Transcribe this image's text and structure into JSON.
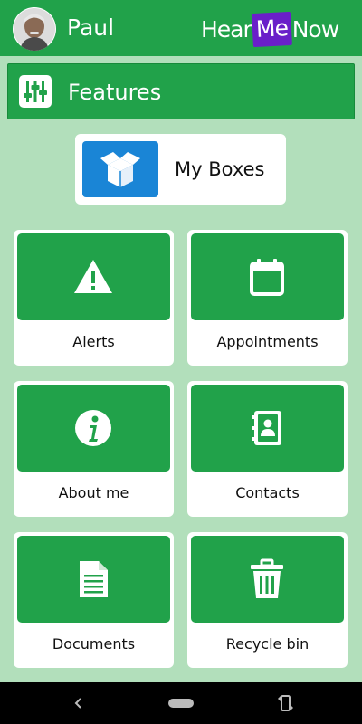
{
  "header": {
    "username": "Paul",
    "logo": {
      "part1": "Hear",
      "part2": "Me",
      "part3": "Now"
    },
    "bg_color": "#21a24a",
    "logo_accent": "#6a1fc9"
  },
  "features": {
    "title": "Features",
    "icon": "sliders-icon"
  },
  "my_boxes": {
    "label": "My Boxes",
    "icon": "open-box-icon",
    "icon_bg": "#1a85d6"
  },
  "tiles": [
    {
      "label": "Alerts",
      "icon": "warning-icon"
    },
    {
      "label": "Appointments",
      "icon": "calendar-icon"
    },
    {
      "label": "About me",
      "icon": "info-icon"
    },
    {
      "label": "Contacts",
      "icon": "address-book-icon"
    },
    {
      "label": "Documents",
      "icon": "document-icon"
    },
    {
      "label": "Recycle bin",
      "icon": "trash-icon"
    }
  ],
  "nav": {
    "back_icon": "back-icon",
    "home_icon": "home-pill",
    "rotate_icon": "rotate-icon"
  },
  "colors": {
    "page_bg": "#b2dfbb",
    "green": "#21a24a",
    "text": "#111111"
  }
}
